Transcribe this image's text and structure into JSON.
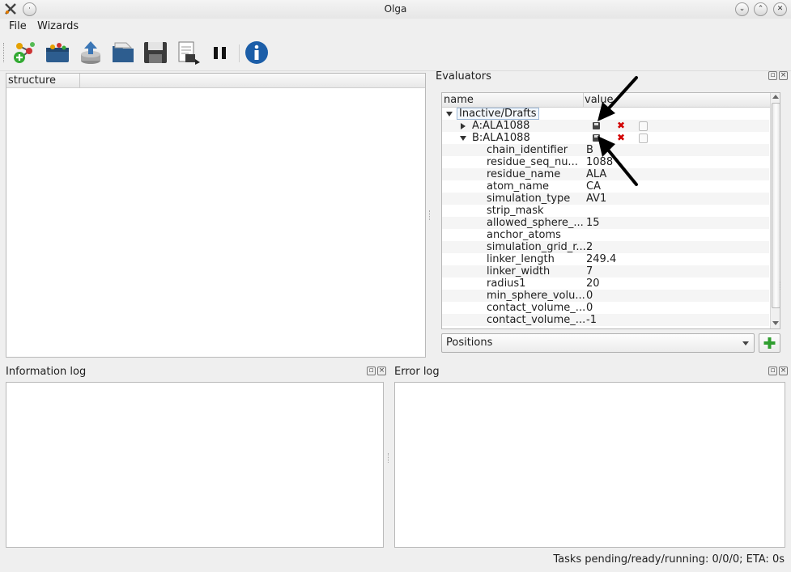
{
  "window": {
    "title": "Olga"
  },
  "menu": {
    "file": "File",
    "wizards": "Wizards"
  },
  "toolbar": {
    "icons": [
      "molecule-add-icon",
      "load-structure-icon",
      "upload-icon",
      "open-folder-icon",
      "save-icon",
      "export-icon",
      "pause-icon",
      "info-icon"
    ]
  },
  "structure_panel": {
    "column_header": "structure"
  },
  "evaluators": {
    "title": "Evaluators",
    "header_name": "name",
    "header_value": "value",
    "group": "Inactive/Drafts",
    "items": [
      "A:ALA1088",
      "B:ALA1088"
    ],
    "properties": [
      {
        "name": "chain_identifier",
        "value": "B"
      },
      {
        "name": "residue_seq_nu...",
        "value": "1088"
      },
      {
        "name": "residue_name",
        "value": "ALA"
      },
      {
        "name": "atom_name",
        "value": "CA"
      },
      {
        "name": "simulation_type",
        "value": "AV1"
      },
      {
        "name": "strip_mask",
        "value": ""
      },
      {
        "name": "allowed_sphere_...",
        "value": "15"
      },
      {
        "name": "anchor_atoms",
        "value": ""
      },
      {
        "name": "simulation_grid_r...",
        "value": "2"
      },
      {
        "name": "linker_length",
        "value": "249.4"
      },
      {
        "name": "linker_width",
        "value": "7"
      },
      {
        "name": "radius1",
        "value": "20"
      },
      {
        "name": "min_sphere_volu...",
        "value": "0"
      },
      {
        "name": "contact_volume_...",
        "value": "0"
      },
      {
        "name": "contact_volume_...",
        "value": "-1"
      }
    ],
    "dropdown_value": "Positions",
    "add_label": "+"
  },
  "info_log": {
    "title": "Information log"
  },
  "error_log": {
    "title": "Error log"
  },
  "status": {
    "text": "Tasks pending/ready/running: 0/0/0; ETA: 0s"
  }
}
